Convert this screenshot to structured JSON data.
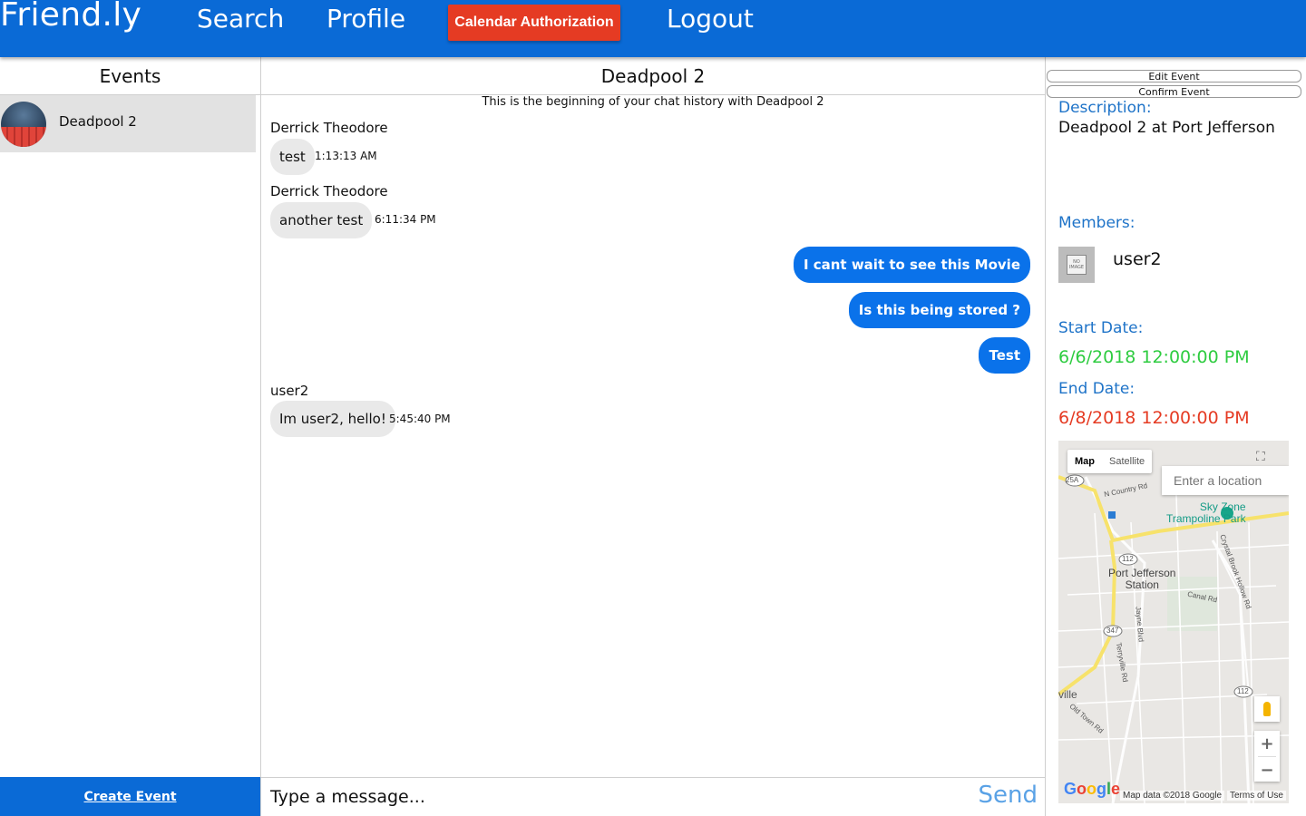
{
  "nav": {
    "brand": "Friend.ly",
    "search": "Search",
    "profile": "Profile",
    "calendar_auth": "Calendar Authorization",
    "logout": "Logout"
  },
  "events_panel": {
    "title": "Events",
    "items": [
      {
        "name": "Deadpool 2"
      }
    ],
    "create_label": "Create Event"
  },
  "chat": {
    "title": "Deadpool 2",
    "beginning_note": "This is the beginning of your chat history with Deadpool 2",
    "messages": [
      {
        "sender": "Derrick Theodore",
        "text": "test",
        "time": "1:13:13 AM",
        "outgoing": false
      },
      {
        "sender": "Derrick Theodore",
        "text": "another test",
        "time": "6:11:34 PM",
        "outgoing": false
      },
      {
        "text": "I cant wait to see this Movie",
        "outgoing": true
      },
      {
        "text": "Is this being stored ?",
        "outgoing": true
      },
      {
        "text": "Test",
        "outgoing": true
      },
      {
        "sender": "user2",
        "text": "Im user2, hello!",
        "time": "5:45:40 PM",
        "outgoing": false
      }
    ],
    "input_placeholder": "Type a message...",
    "send_label": "Send"
  },
  "details": {
    "edit_label": "Edit Event",
    "confirm_label": "Confirm Event",
    "description_label": "Description:",
    "description": "Deadpool 2 at Port Jefferson",
    "members_label": "Members:",
    "members": [
      {
        "name": "user2",
        "avatar_text": "NO IMAGE"
      }
    ],
    "start_label": "Start Date:",
    "start_date": "6/6/2018 12:00:00 PM",
    "end_label": "End Date:",
    "end_date": "6/8/2018 12:00:00 PM"
  },
  "map": {
    "type_map": "Map",
    "type_satellite": "Satellite",
    "search_placeholder": "Enter a location",
    "labels": {
      "poi": "Sky Zone Trampoline Park",
      "poi_line1": "Sky Zone",
      "poi_line2": "Trampoline Park",
      "town_line1": "Port Jefferson",
      "town_line2": "Station",
      "country_rd": "N Country Rd",
      "canal_rd": "Canal Rd",
      "crystal_brook": "Crystal Brook Hollow Rd",
      "jayne_blvd": "Jayne Blvd",
      "terryville_rd": "Terryville Rd",
      "old_town_rd": "Old Town Rd",
      "ville": "ville",
      "route_25a": "25A",
      "route_112": "112",
      "route_347": "347"
    },
    "attribution": "Map data ©2018 Google",
    "terms": "Terms of Use",
    "logo": "Google"
  },
  "colors": {
    "brand_blue": "#0a6ad6",
    "outgoing_bubble": "#0a72ea",
    "calendar_red": "#e53b23",
    "start_green": "#2ecc40",
    "end_red": "#e53b23",
    "label_blue": "#1e73c8"
  },
  "icons": {
    "fullscreen": "fullscreen-icon",
    "pegman": "street-view-pegman-icon",
    "zoom_in": "zoom-in-icon",
    "zoom_out": "zoom-out-icon"
  }
}
